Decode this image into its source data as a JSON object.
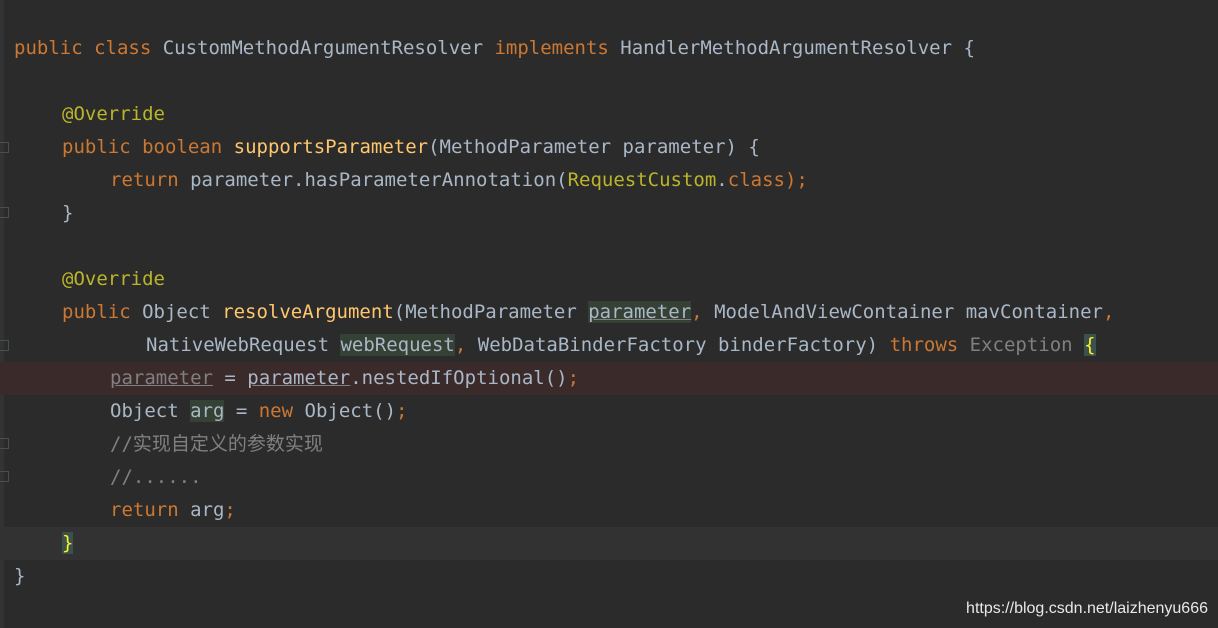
{
  "editor": {
    "lines": [
      {
        "t1": "public",
        "t2": " ",
        "t3": "class",
        "t4": " CustomMethodArgumentResolver ",
        "t5": "implements",
        "t6": " HandlerMethodArgumentResolver {"
      },
      {},
      {
        "t1": "@Override"
      },
      {
        "t1": "public",
        "t2": " ",
        "t3": "boolean",
        "t4": " ",
        "t5": "supportsParameter",
        "t6": "(MethodParameter parameter) {"
      },
      {
        "t1": "return",
        "t2": " parameter.hasParameterAnnotation(",
        "t3": "RequestCustom",
        "t4": ".",
        "t5": "class",
        "t6": ");"
      },
      {
        "t1": "}"
      },
      {},
      {
        "t1": "@Override"
      },
      {
        "t1": "public",
        "t2": " Object ",
        "t3": "resolveArgument",
        "t4": "(MethodParameter ",
        "t5": "parameter",
        "t6": ",",
        "t7": " ModelAndViewContainer mavContainer",
        "t8": ","
      },
      {
        "t1": "NativeWebRequest ",
        "t2": "webRequest",
        "t3": ",",
        "t4": " WebDataBinderFactory binderFactory) ",
        "t5": "throws",
        "t6": " ",
        "t7": "Exception",
        "t8": " ",
        "t9": "{"
      },
      {
        "t1": "parameter",
        "t2": " = ",
        "t3": "parameter",
        "t4": ".nestedIfOptional()",
        "t5": ";"
      },
      {
        "t1": "Object ",
        "t2": "arg",
        "t3": " = ",
        "t4": "new",
        "t5": " Object()",
        "t6": ";"
      },
      {
        "t1": "//实现自定义的参数实现"
      },
      {
        "t1": "//......"
      },
      {
        "t1": "return",
        "t2": " arg",
        "t3": ";"
      },
      {
        "t1": "}"
      },
      {
        "t1": "}"
      }
    ]
  },
  "watermark": {
    "text": "https://blog.csdn.net/laizhenyu666"
  },
  "colors": {
    "background": "#2b2b2b",
    "keyword": "#cc7832",
    "annotation": "#bbb529",
    "method": "#ffc66d",
    "text": "#a9b7c6",
    "comment": "#808080"
  }
}
